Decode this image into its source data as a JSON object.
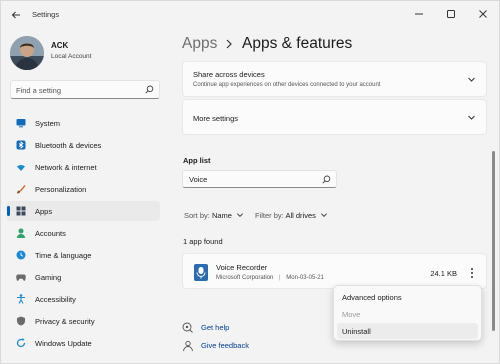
{
  "window": {
    "title": "Settings"
  },
  "user": {
    "name": "ACK",
    "account_type": "Local Account"
  },
  "sidebar": {
    "search_placeholder": "Find a setting",
    "items": [
      {
        "label": "System",
        "icon": "monitor-icon",
        "color": "#0f6cbd"
      },
      {
        "label": "Bluetooth & devices",
        "icon": "bluetooth-icon",
        "color": "#0f6cbd"
      },
      {
        "label": "Network & internet",
        "icon": "wifi-icon",
        "color": "#1b8ad6"
      },
      {
        "label": "Personalization",
        "icon": "brush-icon",
        "color": "#d4662b"
      },
      {
        "label": "Apps",
        "icon": "apps-grid-icon",
        "color": "#3d4a5c",
        "active": true
      },
      {
        "label": "Accounts",
        "icon": "person-icon",
        "color": "#2fa36b"
      },
      {
        "label": "Time & language",
        "icon": "globe-clock-icon",
        "color": "#1b8ad6"
      },
      {
        "label": "Gaming",
        "icon": "gamepad-icon",
        "color": "#6b6b6b"
      },
      {
        "label": "Accessibility",
        "icon": "accessibility-icon",
        "color": "#1b8ad6"
      },
      {
        "label": "Privacy & security",
        "icon": "shield-icon",
        "color": "#6b6b6b"
      },
      {
        "label": "Windows Update",
        "icon": "update-icon",
        "color": "#1b8ad6"
      }
    ]
  },
  "breadcrumb": {
    "parent": "Apps",
    "current": "Apps & features"
  },
  "cards": {
    "share_title": "Share across devices",
    "share_subtitle": "Continue app experiences on other devices connected to your account",
    "more_settings": "More settings"
  },
  "app_list": {
    "heading": "App list",
    "search_value": "Voice",
    "sort_label": "Sort by:",
    "sort_value": "Name",
    "filter_label": "Filter by:",
    "filter_value": "All drives",
    "found_text": "1 app found",
    "apps": [
      {
        "name": "Voice Recorder",
        "publisher": "Microsoft Corporation",
        "date": "Mon-03-05-21",
        "size": "24.1 KB"
      }
    ]
  },
  "context_menu": {
    "items": [
      {
        "label": "Advanced options",
        "enabled": true
      },
      {
        "label": "Move",
        "enabled": false
      },
      {
        "label": "Uninstall",
        "enabled": true
      }
    ]
  },
  "help": {
    "get_help": "Get help",
    "give_feedback": "Give feedback"
  },
  "colors": {
    "accent": "#005fb8",
    "link": "#003e92",
    "background": "#f3f3f3",
    "card": "#fbfbfb"
  }
}
